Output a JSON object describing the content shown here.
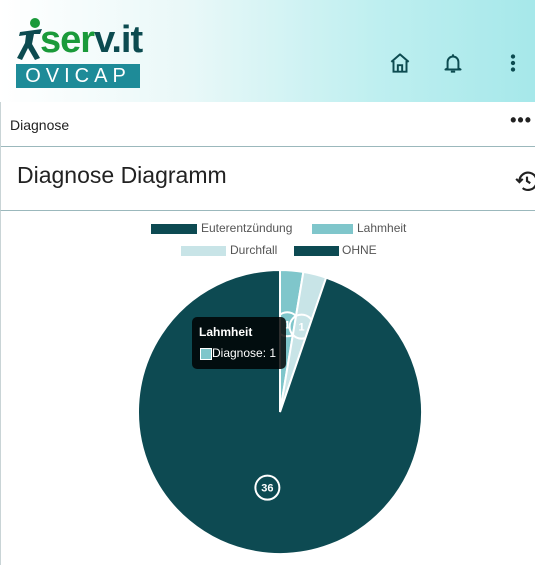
{
  "header": {
    "logo_prefix": "ser",
    "logo_brand": "v.it",
    "logo_product": "OVICAP",
    "icons": [
      "home-icon",
      "bell-icon",
      "more-vert-icon"
    ]
  },
  "breadcrumb": {
    "label": "Diagnose",
    "more": "•••"
  },
  "page": {
    "title": "Diagnose Diagramm",
    "action_icon": "history-icon"
  },
  "chart_data": {
    "type": "pie",
    "categories": [
      "Euterentzündung",
      "Lahmheit",
      "Durchfall",
      "OHNE"
    ],
    "values": [
      0,
      1,
      1,
      36
    ],
    "colors": [
      "#0d4a52",
      "#7fc6cb",
      "#c8e4e7",
      "#0d4a52"
    ],
    "data_labels": [
      "",
      "1",
      "1",
      "36"
    ],
    "legend": "top",
    "tooltip": {
      "title": "Lahmheit",
      "label": "Diagnose: 1"
    }
  }
}
